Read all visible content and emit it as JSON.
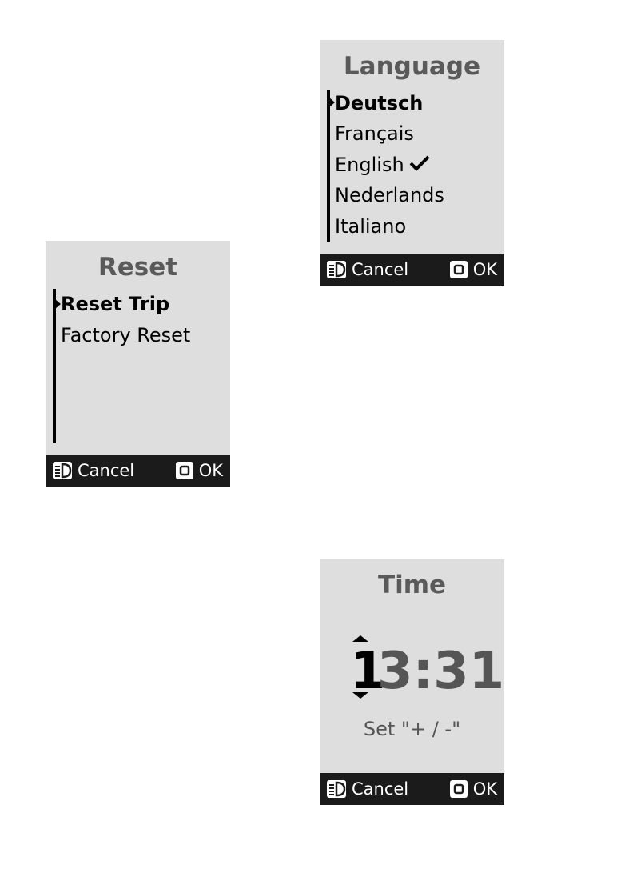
{
  "language_screen": {
    "title": "Language",
    "items": [
      {
        "label": "Deutsch",
        "selected": true
      },
      {
        "label": "Français",
        "selected": false
      },
      {
        "label": "English",
        "selected": false,
        "checked": true
      },
      {
        "label": "Nederlands",
        "selected": false
      },
      {
        "label": "Italiano",
        "selected": false
      }
    ],
    "footer": {
      "cancel_label": "Cancel",
      "ok_label": "OK"
    }
  },
  "reset_screen": {
    "title": "Reset",
    "items": [
      {
        "label": "Reset Trip",
        "selected": true
      },
      {
        "label": "Factory Reset",
        "selected": false
      }
    ],
    "footer": {
      "cancel_label": "Cancel",
      "ok_label": "OK"
    }
  },
  "time_screen": {
    "title": "Time",
    "active_digit": "1",
    "rest_digits": "3:31",
    "hint": "Set \"+ / -\"",
    "footer": {
      "cancel_label": "Cancel",
      "ok_label": "OK"
    }
  },
  "icons": {
    "cancel": "headlight-icon",
    "ok": "square-button-icon",
    "check": "checkmark-icon"
  },
  "colors": {
    "screen_bg": "#dededf",
    "footer_bg": "#1b1b1b",
    "title_gray": "#5a5a5a"
  }
}
